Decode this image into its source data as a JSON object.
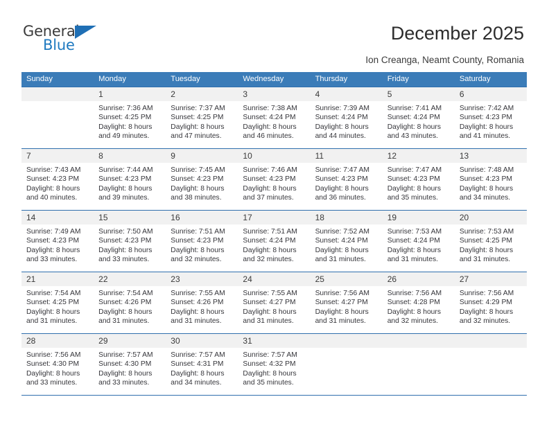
{
  "brand": {
    "logo_primary": "General",
    "logo_secondary": "Blue",
    "logo_icon": "blue-triangle-icon",
    "accent_color": "#1f6fb5"
  },
  "header": {
    "title": "December 2025",
    "subtitle": "Ion Creanga, Neamt County, Romania"
  },
  "colors": {
    "header_row_bg": "#3b7cb8",
    "header_row_text": "#ffffff",
    "day_number_bg": "#f1f1f1",
    "grid_line": "#2f6fad",
    "body_text": "#35353a"
  },
  "weekday_headers": [
    "Sunday",
    "Monday",
    "Tuesday",
    "Wednesday",
    "Thursday",
    "Friday",
    "Saturday"
  ],
  "labels": {
    "sunrise_prefix": "Sunrise:",
    "sunset_prefix": "Sunset:",
    "daylight_prefix": "Daylight:"
  },
  "chart_data": {
    "type": "table",
    "title": "December 2025 — Sunrise, Sunset and Daylight",
    "location": "Ion Creanga, Neamt County, Romania",
    "columns": [
      "Sunday",
      "Monday",
      "Tuesday",
      "Wednesday",
      "Thursday",
      "Friday",
      "Saturday"
    ],
    "days": [
      {
        "day": 1,
        "weekday": "Monday",
        "sunrise": "7:36 AM",
        "sunset": "4:25 PM",
        "daylight_hours": 8,
        "daylight_minutes": 49
      },
      {
        "day": 2,
        "weekday": "Tuesday",
        "sunrise": "7:37 AM",
        "sunset": "4:25 PM",
        "daylight_hours": 8,
        "daylight_minutes": 47
      },
      {
        "day": 3,
        "weekday": "Wednesday",
        "sunrise": "7:38 AM",
        "sunset": "4:24 PM",
        "daylight_hours": 8,
        "daylight_minutes": 46
      },
      {
        "day": 4,
        "weekday": "Thursday",
        "sunrise": "7:39 AM",
        "sunset": "4:24 PM",
        "daylight_hours": 8,
        "daylight_minutes": 44
      },
      {
        "day": 5,
        "weekday": "Friday",
        "sunrise": "7:41 AM",
        "sunset": "4:24 PM",
        "daylight_hours": 8,
        "daylight_minutes": 43
      },
      {
        "day": 6,
        "weekday": "Saturday",
        "sunrise": "7:42 AM",
        "sunset": "4:23 PM",
        "daylight_hours": 8,
        "daylight_minutes": 41
      },
      {
        "day": 7,
        "weekday": "Sunday",
        "sunrise": "7:43 AM",
        "sunset": "4:23 PM",
        "daylight_hours": 8,
        "daylight_minutes": 40
      },
      {
        "day": 8,
        "weekday": "Monday",
        "sunrise": "7:44 AM",
        "sunset": "4:23 PM",
        "daylight_hours": 8,
        "daylight_minutes": 39
      },
      {
        "day": 9,
        "weekday": "Tuesday",
        "sunrise": "7:45 AM",
        "sunset": "4:23 PM",
        "daylight_hours": 8,
        "daylight_minutes": 38
      },
      {
        "day": 10,
        "weekday": "Wednesday",
        "sunrise": "7:46 AM",
        "sunset": "4:23 PM",
        "daylight_hours": 8,
        "daylight_minutes": 37
      },
      {
        "day": 11,
        "weekday": "Thursday",
        "sunrise": "7:47 AM",
        "sunset": "4:23 PM",
        "daylight_hours": 8,
        "daylight_minutes": 36
      },
      {
        "day": 12,
        "weekday": "Friday",
        "sunrise": "7:47 AM",
        "sunset": "4:23 PM",
        "daylight_hours": 8,
        "daylight_minutes": 35
      },
      {
        "day": 13,
        "weekday": "Saturday",
        "sunrise": "7:48 AM",
        "sunset": "4:23 PM",
        "daylight_hours": 8,
        "daylight_minutes": 34
      },
      {
        "day": 14,
        "weekday": "Sunday",
        "sunrise": "7:49 AM",
        "sunset": "4:23 PM",
        "daylight_hours": 8,
        "daylight_minutes": 33
      },
      {
        "day": 15,
        "weekday": "Monday",
        "sunrise": "7:50 AM",
        "sunset": "4:23 PM",
        "daylight_hours": 8,
        "daylight_minutes": 33
      },
      {
        "day": 16,
        "weekday": "Tuesday",
        "sunrise": "7:51 AM",
        "sunset": "4:23 PM",
        "daylight_hours": 8,
        "daylight_minutes": 32
      },
      {
        "day": 17,
        "weekday": "Wednesday",
        "sunrise": "7:51 AM",
        "sunset": "4:24 PM",
        "daylight_hours": 8,
        "daylight_minutes": 32
      },
      {
        "day": 18,
        "weekday": "Thursday",
        "sunrise": "7:52 AM",
        "sunset": "4:24 PM",
        "daylight_hours": 8,
        "daylight_minutes": 31
      },
      {
        "day": 19,
        "weekday": "Friday",
        "sunrise": "7:53 AM",
        "sunset": "4:24 PM",
        "daylight_hours": 8,
        "daylight_minutes": 31
      },
      {
        "day": 20,
        "weekday": "Saturday",
        "sunrise": "7:53 AM",
        "sunset": "4:25 PM",
        "daylight_hours": 8,
        "daylight_minutes": 31
      },
      {
        "day": 21,
        "weekday": "Sunday",
        "sunrise": "7:54 AM",
        "sunset": "4:25 PM",
        "daylight_hours": 8,
        "daylight_minutes": 31
      },
      {
        "day": 22,
        "weekday": "Monday",
        "sunrise": "7:54 AM",
        "sunset": "4:26 PM",
        "daylight_hours": 8,
        "daylight_minutes": 31
      },
      {
        "day": 23,
        "weekday": "Tuesday",
        "sunrise": "7:55 AM",
        "sunset": "4:26 PM",
        "daylight_hours": 8,
        "daylight_minutes": 31
      },
      {
        "day": 24,
        "weekday": "Wednesday",
        "sunrise": "7:55 AM",
        "sunset": "4:27 PM",
        "daylight_hours": 8,
        "daylight_minutes": 31
      },
      {
        "day": 25,
        "weekday": "Thursday",
        "sunrise": "7:56 AM",
        "sunset": "4:27 PM",
        "daylight_hours": 8,
        "daylight_minutes": 31
      },
      {
        "day": 26,
        "weekday": "Friday",
        "sunrise": "7:56 AM",
        "sunset": "4:28 PM",
        "daylight_hours": 8,
        "daylight_minutes": 32
      },
      {
        "day": 27,
        "weekday": "Saturday",
        "sunrise": "7:56 AM",
        "sunset": "4:29 PM",
        "daylight_hours": 8,
        "daylight_minutes": 32
      },
      {
        "day": 28,
        "weekday": "Sunday",
        "sunrise": "7:56 AM",
        "sunset": "4:30 PM",
        "daylight_hours": 8,
        "daylight_minutes": 33
      },
      {
        "day": 29,
        "weekday": "Monday",
        "sunrise": "7:57 AM",
        "sunset": "4:30 PM",
        "daylight_hours": 8,
        "daylight_minutes": 33
      },
      {
        "day": 30,
        "weekday": "Tuesday",
        "sunrise": "7:57 AM",
        "sunset": "4:31 PM",
        "daylight_hours": 8,
        "daylight_minutes": 34
      },
      {
        "day": 31,
        "weekday": "Wednesday",
        "sunrise": "7:57 AM",
        "sunset": "4:32 PM",
        "daylight_hours": 8,
        "daylight_minutes": 35
      }
    ],
    "weeks": [
      [
        null,
        1,
        2,
        3,
        4,
        5,
        6
      ],
      [
        7,
        8,
        9,
        10,
        11,
        12,
        13
      ],
      [
        14,
        15,
        16,
        17,
        18,
        19,
        20
      ],
      [
        21,
        22,
        23,
        24,
        25,
        26,
        27
      ],
      [
        28,
        29,
        30,
        31,
        null,
        null,
        null
      ]
    ]
  }
}
